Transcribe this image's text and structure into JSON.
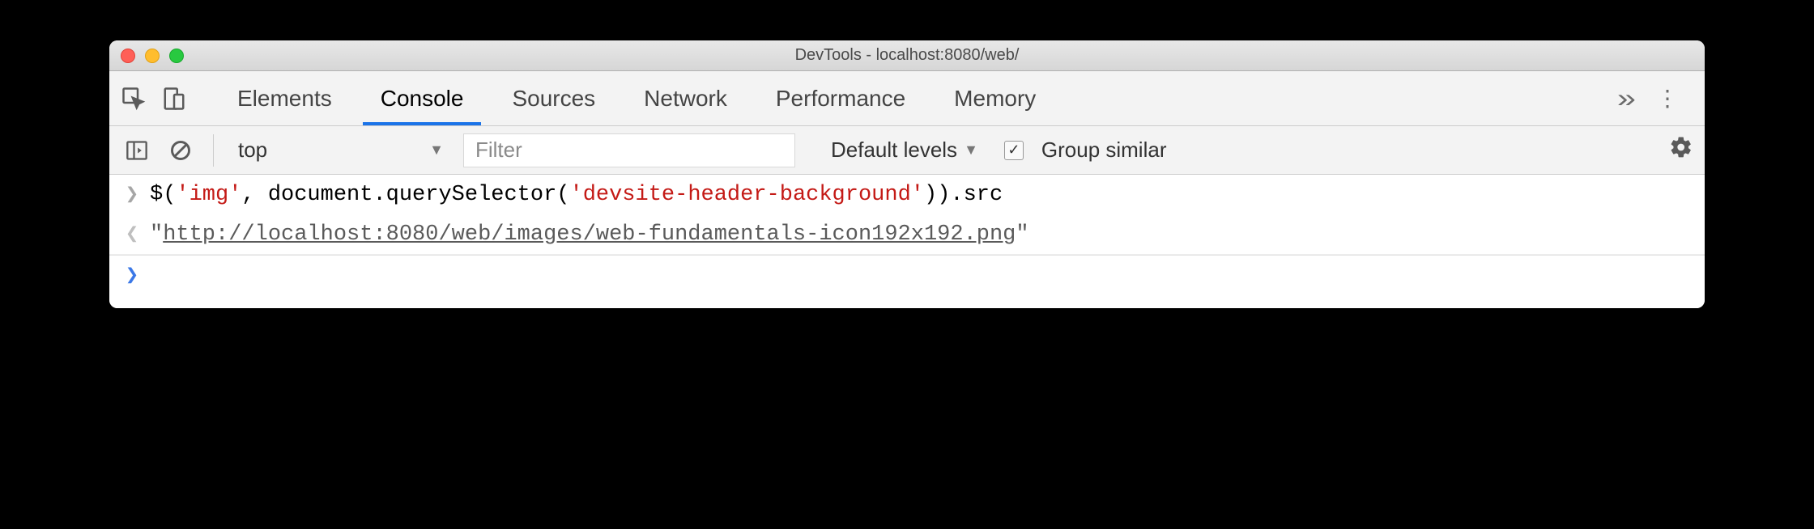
{
  "window": {
    "title": "DevTools - localhost:8080/web/"
  },
  "tabs": {
    "items": [
      {
        "label": "Elements"
      },
      {
        "label": "Console"
      },
      {
        "label": "Sources"
      },
      {
        "label": "Network"
      },
      {
        "label": "Performance"
      },
      {
        "label": "Memory"
      }
    ],
    "active_index": 1
  },
  "toolbar": {
    "context": "top",
    "filter_placeholder": "Filter",
    "levels_label": "Default levels",
    "group_similar_label": "Group similar",
    "group_similar_checked": true
  },
  "console": {
    "input_tokens": {
      "fn1": "$",
      "p1": "(",
      "str1": "'img'",
      "comma": ", ",
      "doc": "document",
      "dot1": ".",
      "qs": "querySelector",
      "p2": "(",
      "str2": "'devsite-header-background'",
      "p3": ")",
      "p4": ")",
      "dot2": ".",
      "prop": "src"
    },
    "output_quote_open": "\"",
    "output_url": "http://localhost:8080/web/images/web-fundamentals-icon192x192.png",
    "output_quote_close": "\""
  }
}
